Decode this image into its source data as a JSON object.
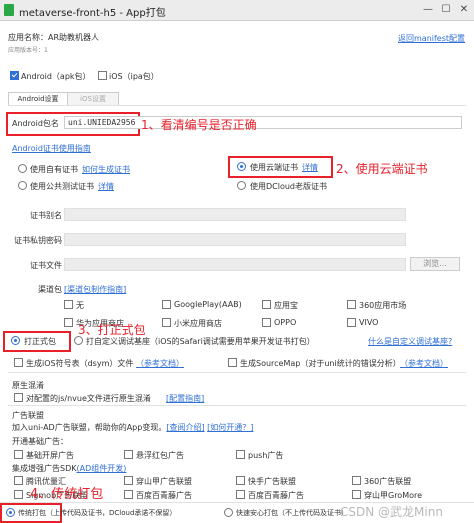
{
  "window": {
    "title": "metaverse-front-h5 - App打包"
  },
  "app": {
    "name_label": "应用名称：",
    "name_value": "AR助教机器人",
    "version_label": "应用版本号：1",
    "manifest_link": "返回manifest配置"
  },
  "platforms": {
    "android": "Android（apk包）",
    "ios": "iOS（ipa包）"
  },
  "tabs": {
    "android": "Android设置",
    "ios": "iOS设置"
  },
  "package": {
    "label": "Android包名",
    "value": "uni.UNIEDA2956"
  },
  "annotations": {
    "a1": "1、看清编号是否正确",
    "a2": "2、使用云端证书",
    "a3": "3、打正式包",
    "a4": "4、传统打包"
  },
  "cert": {
    "guide_link": "Android证书使用指南",
    "own": "使用自有证书",
    "own_link": "如何生成证书",
    "public_test": "使用公共测试证书",
    "public_test_link": "详情",
    "cloud": "使用云端证书",
    "cloud_link": "详情",
    "dcloud_old": "使用DCloud老版证书",
    "alias_label": "证书别名",
    "password_label": "证书私钥密码",
    "file_label": "证书文件",
    "browse": "浏览..."
  },
  "channels": {
    "label": "渠道包",
    "link": "[渠道包制作指南]",
    "items": [
      "无",
      "GooglePlay(AAB)",
      "应用宝",
      "360应用市场",
      "华为应用商店",
      "小米应用商店",
      "OPPO",
      "VIVO"
    ]
  },
  "build_type": {
    "release": "打正式包",
    "custom": "打自定义调试基座（iOS的Safari调试需要用苹果开发证书打包）",
    "custom_link": "什么是自定义调试基座?"
  },
  "options": {
    "dsym": "生成iOS符号表（dsym）文件",
    "dsym_link": "（参考文档）",
    "sourcemap": "生成SourceMap（对于uni统计的错误分析）",
    "sourcemap_link": "（参考文档）"
  },
  "obfuscation": {
    "title": "原生混淆",
    "item": "对配置的js/nvue文件进行原生混淆",
    "link": "[配置指南]"
  },
  "ads": {
    "title": "广告联盟",
    "intro": "加入uni-AD广告联盟，帮助你的App变现。",
    "intro_link1": "[查阅介绍]",
    "intro_link2": "[如何开通？]",
    "basic_label": "开通基础广告：",
    "basic": [
      "基础开屏广告",
      "悬浮红包广告",
      "push广告"
    ],
    "enhanced_label": "集成增强广告SDK",
    "enhanced_link": "(AD组件开发)",
    "enhanced": [
      [
        "腾讯优量汇",
        "穿山甲广告联盟",
        "快手广告联盟",
        "360广告联盟"
      ],
      [
        "Sigmob广告联盟",
        "百度百青藤广告",
        "百度百青藤广告",
        "穿山甲GroMore"
      ]
    ]
  },
  "bottom": {
    "traditional": "传统打包（上传代码及证书，DCloud承诺不保留）",
    "safe": "快速安心打包（不上传代码及证书）",
    "watermark": "CSDN @武龙Minn"
  },
  "colors": {
    "accent": "#2f6fd6",
    "annotation": "#e8202a"
  }
}
